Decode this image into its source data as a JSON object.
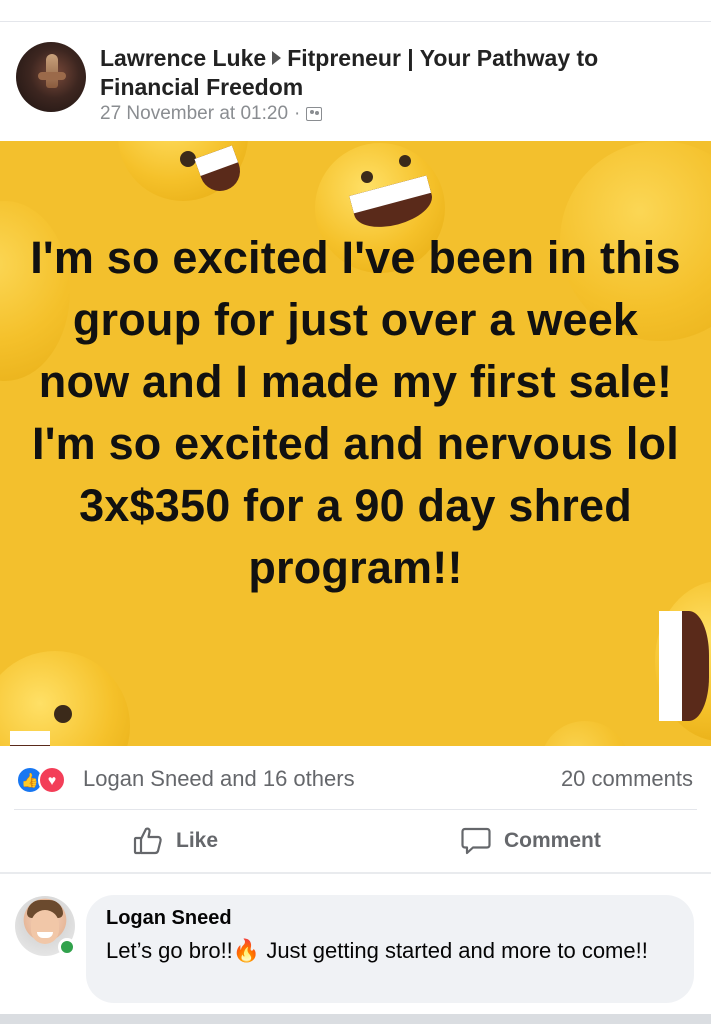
{
  "post": {
    "author": "Lawrence Luke",
    "group": "Fitpreneur | Your Pathway to Financial Freedom",
    "timestamp": "27 November at 01:20",
    "separator": "·",
    "privacy_icon": "group-icon",
    "image_text": "I'm so excited I've been in this group for just over a week now and I made my first sale! I'm so excited and nervous lol 3x$350 for a 90 day shred program!!",
    "image_bg_color": "#f3c02d"
  },
  "reactions": {
    "icons": [
      "like-reaction-icon",
      "love-reaction-icon"
    ],
    "summary": "Logan Sneed and 16 others",
    "comments": "20 comments",
    "like_color": "#1877f2",
    "love_color": "#f33e58"
  },
  "actions": {
    "like_label": "Like",
    "comment_label": "Comment"
  },
  "comment": {
    "author": "Logan Sneed",
    "text_before": "Let’s go bro!!",
    "emoji": "🔥",
    "text_after": " Just getting started and more to come!!",
    "online": true
  }
}
